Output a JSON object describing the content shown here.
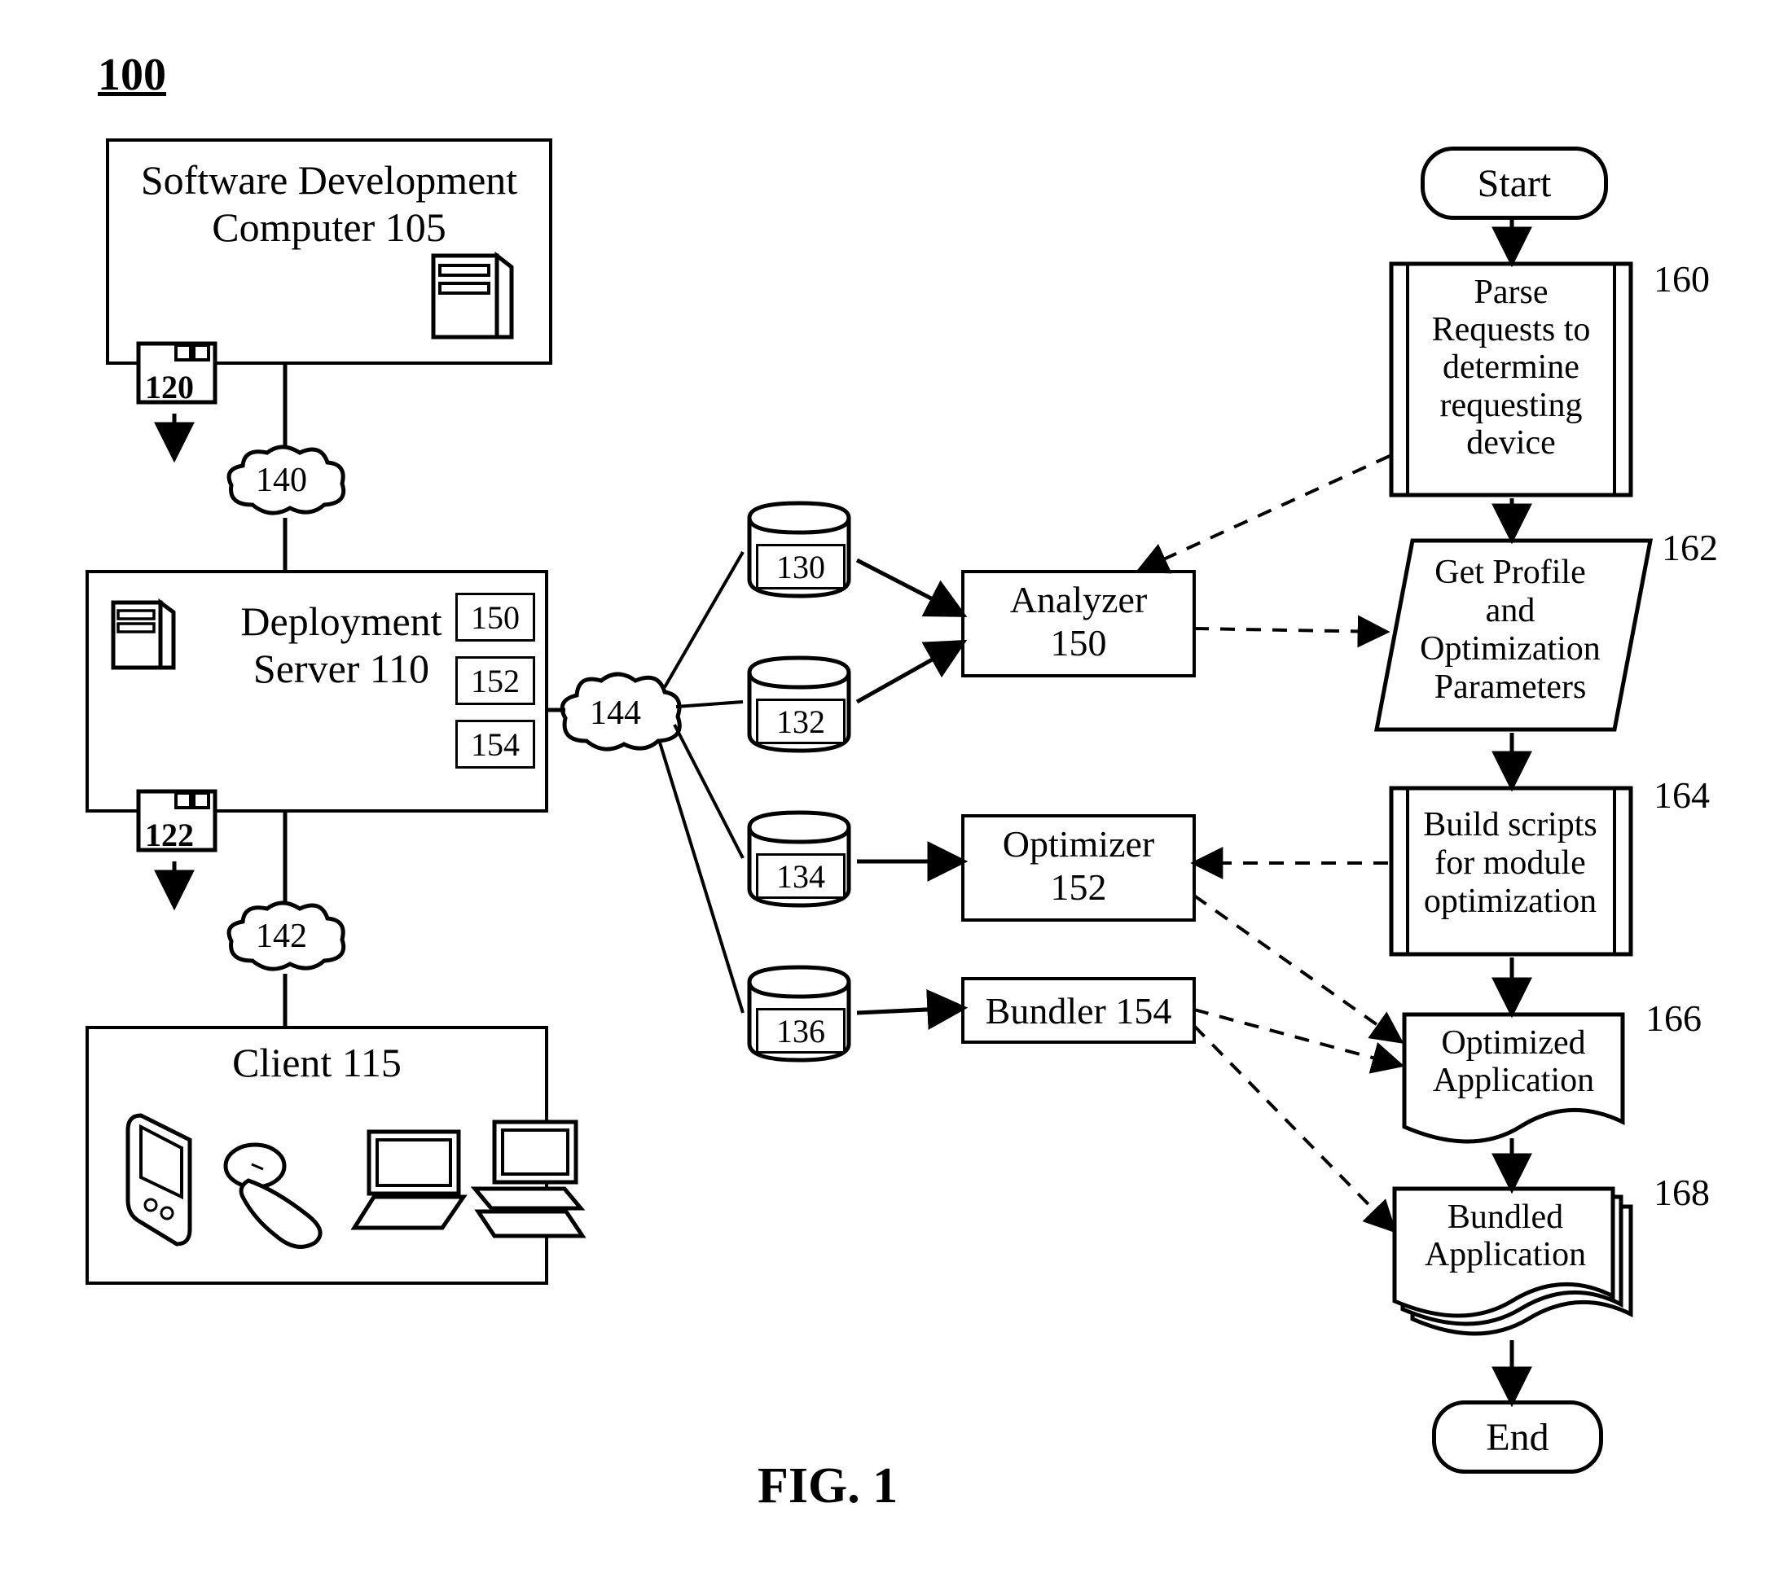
{
  "figure": {
    "ref": "100",
    "caption": "FIG. 1"
  },
  "blocks": {
    "dev_computer": {
      "line1": "Software Development",
      "line2": "Computer 105"
    },
    "deploy_server": {
      "line1": "Deployment",
      "line2": "Server 110"
    },
    "client": "Client 115",
    "analyzer": {
      "line1": "Analyzer",
      "line2": "150"
    },
    "optimizer": {
      "line1": "Optimizer",
      "line2": "152"
    },
    "bundler": "Bundler 154",
    "ds_inner": {
      "a": "150",
      "b": "152",
      "c": "154"
    },
    "disk_120": "120",
    "disk_122": "122"
  },
  "clouds": {
    "c140": "140",
    "c142": "142",
    "c144": "144"
  },
  "dbs": {
    "d130": "130",
    "d132": "132",
    "d134": "134",
    "d136": "136"
  },
  "flow": {
    "start": "Start",
    "end": "End",
    "step160": {
      "l1": "Parse",
      "l2": "Requests to",
      "l3": "determine",
      "l4": "requesting",
      "l5": "device",
      "ref": "160"
    },
    "step162": {
      "l1": "Get Profile",
      "l2": "and",
      "l3": "Optimization",
      "l4": "Parameters",
      "ref": "162"
    },
    "step164": {
      "l1": "Build scripts",
      "l2": "for module",
      "l3": "optimization",
      "ref": "164"
    },
    "step166": {
      "l1": "Optimized",
      "l2": "Application",
      "ref": "166"
    },
    "step168": {
      "l1": "Bundled",
      "l2": "Application",
      "ref": "168"
    }
  }
}
